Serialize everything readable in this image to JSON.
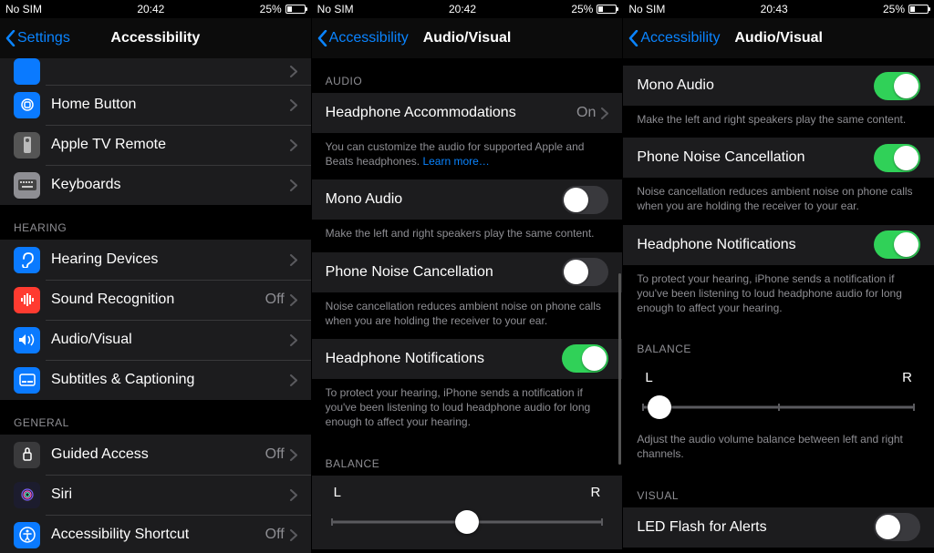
{
  "status": {
    "carrier": "No SIM",
    "time1": "20:42",
    "time2": "20:42",
    "time3": "20:43",
    "battery": "25%"
  },
  "panel1": {
    "back": "Settings",
    "title": "Accessibility",
    "rows": {
      "home": "Home Button",
      "appletv": "Apple TV Remote",
      "keyboards": "Keyboards"
    },
    "hearing_label": "HEARING",
    "hearing": {
      "devices": "Hearing Devices",
      "sound": "Sound Recognition",
      "sound_detail": "Off",
      "audio": "Audio/Visual",
      "subs": "Subtitles & Captioning"
    },
    "general_label": "GENERAL",
    "general": {
      "guided": "Guided Access",
      "guided_detail": "Off",
      "siri": "Siri",
      "shortcut": "Accessibility Shortcut",
      "shortcut_detail": "Off"
    }
  },
  "panel2": {
    "back": "Accessibility",
    "title": "Audio/Visual",
    "audio_label": "AUDIO",
    "hp_accom": "Headphone Accommodations",
    "hp_accom_detail": "On",
    "hp_accom_foot": "You can customize the audio for supported Apple and Beats headphones. ",
    "hp_accom_link": "Learn more…",
    "mono": "Mono Audio",
    "mono_foot": "Make the left and right speakers play the same content.",
    "noise": "Phone Noise Cancellation",
    "noise_foot": "Noise cancellation reduces ambient noise on phone calls when you are holding the receiver to your ear.",
    "hpnotif": "Headphone Notifications",
    "hpnotif_foot": "To protect your hearing, iPhone sends a notification if you've been listening to loud headphone audio for long enough to affect your hearing.",
    "balance_label": "BALANCE",
    "L": "L",
    "R": "R"
  },
  "panel3": {
    "back": "Accessibility",
    "title": "Audio/Visual",
    "mono": "Mono Audio",
    "mono_foot": "Make the left and right speakers play the same content.",
    "noise": "Phone Noise Cancellation",
    "noise_foot": "Noise cancellation reduces ambient noise on phone calls when you are holding the receiver to your ear.",
    "hpnotif": "Headphone Notifications",
    "hpnotif_foot": "To protect your hearing, iPhone sends a notification if you've been listening to loud headphone audio for long enough to affect your hearing.",
    "balance_label": "BALANCE",
    "L": "L",
    "R": "R",
    "balance_foot": "Adjust the audio volume balance between left and right channels.",
    "visual_label": "VISUAL",
    "led": "LED Flash for Alerts"
  }
}
